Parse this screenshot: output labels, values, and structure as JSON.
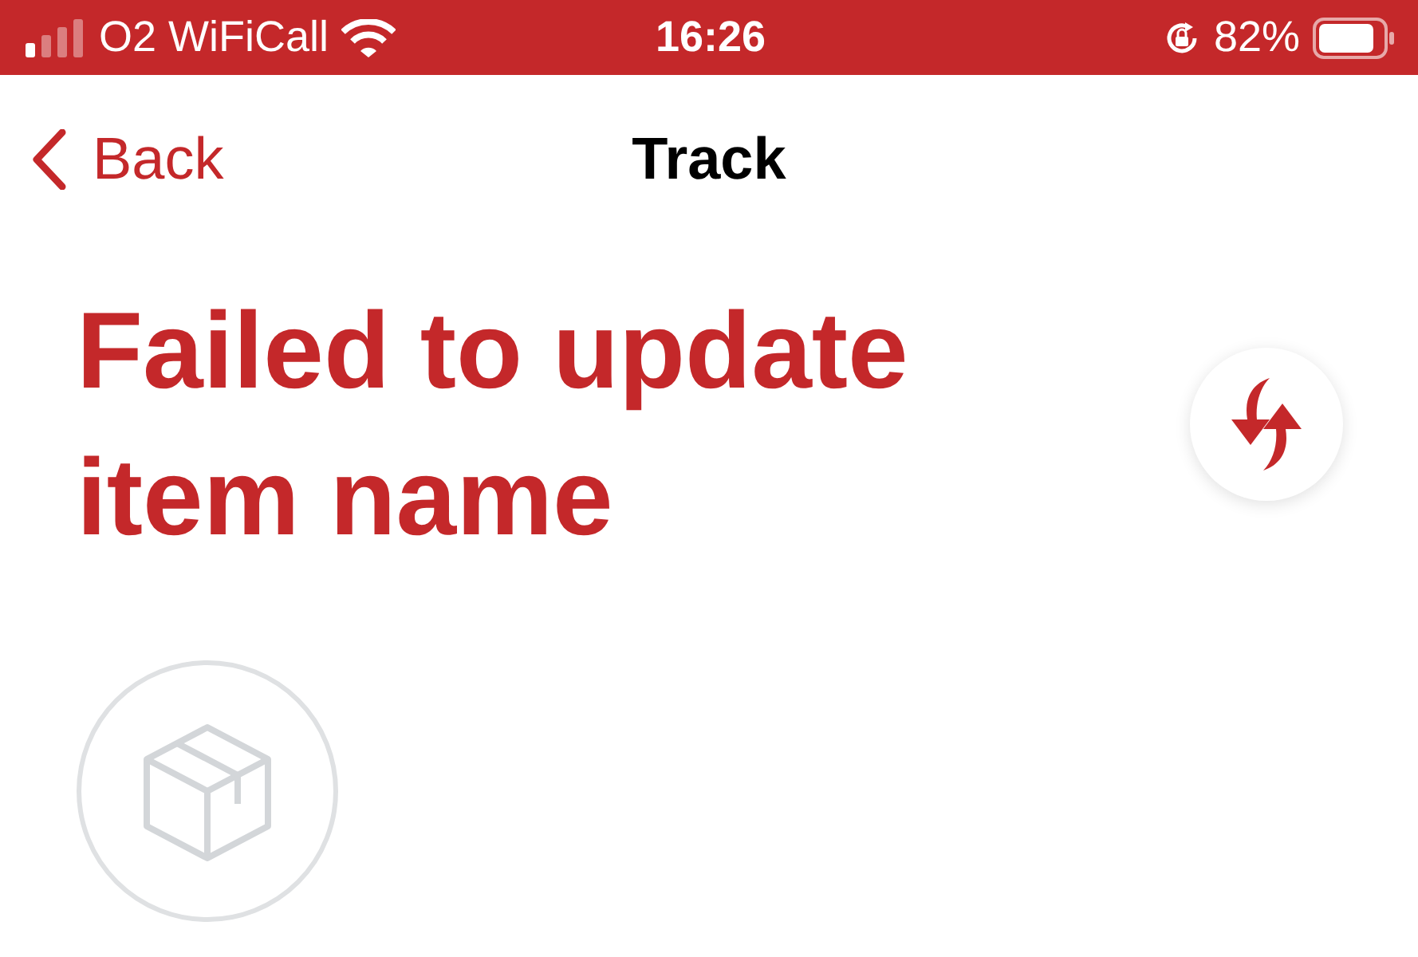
{
  "status_bar": {
    "carrier": "O2 WiFiCall",
    "time": "16:26",
    "battery": "82%"
  },
  "nav": {
    "back": "Back",
    "title": "Track"
  },
  "heading": "Failed to update item name"
}
